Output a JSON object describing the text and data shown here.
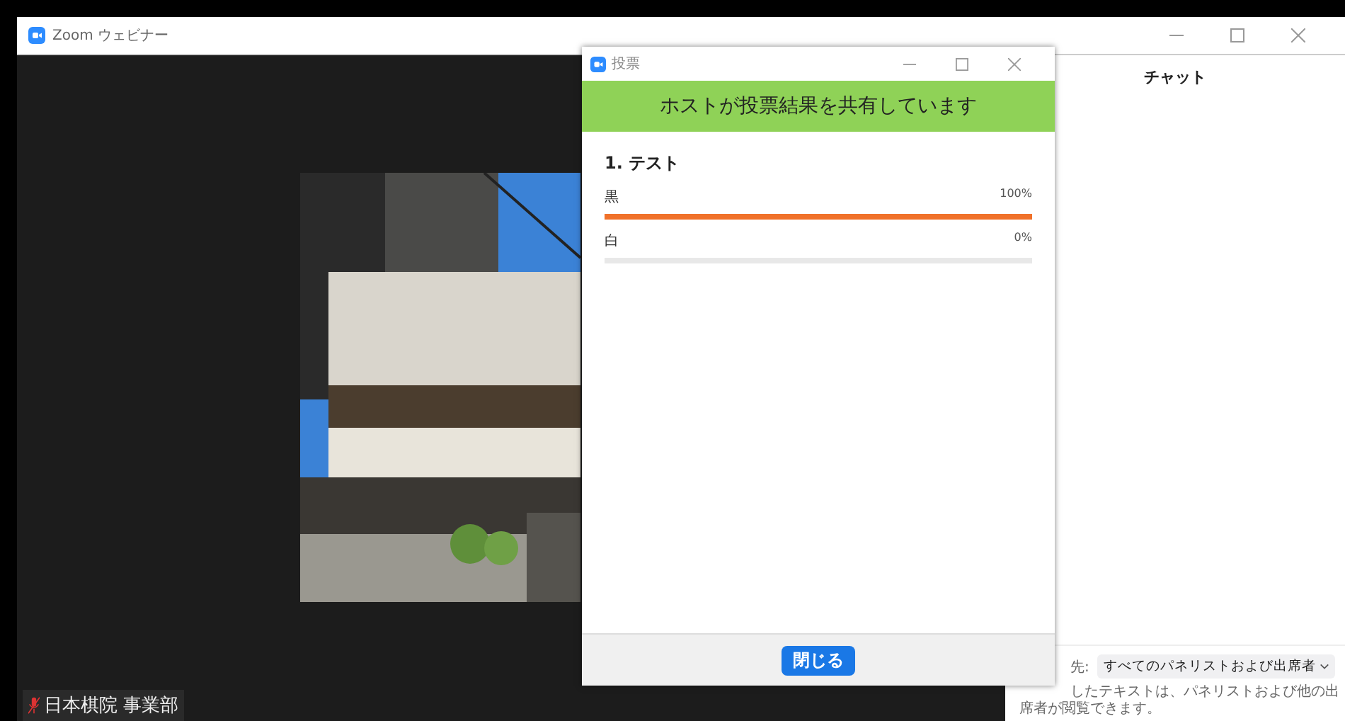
{
  "window": {
    "title": "Zoom ウェビナー"
  },
  "video": {
    "kind": "picture",
    "participant": "日本棋院 事業部",
    "muted": true
  },
  "chat": {
    "title": "チャット",
    "to_label": "先:",
    "recipient": "すべてのパネリストおよび出席者",
    "note_lines": [
      "したテキストは、パネリストおよび他の出",
      "席者が閲覧できます。"
    ]
  },
  "poll": {
    "title": "投票",
    "banner": "ホストが投票結果を共有しています",
    "question": "1. テスト",
    "options": [
      {
        "label": "黒",
        "reading": "100%",
        "level": 1.0
      },
      {
        "label": "白",
        "reading": "0%",
        "level": 0.0
      }
    ],
    "close_button": "閉じる"
  }
}
